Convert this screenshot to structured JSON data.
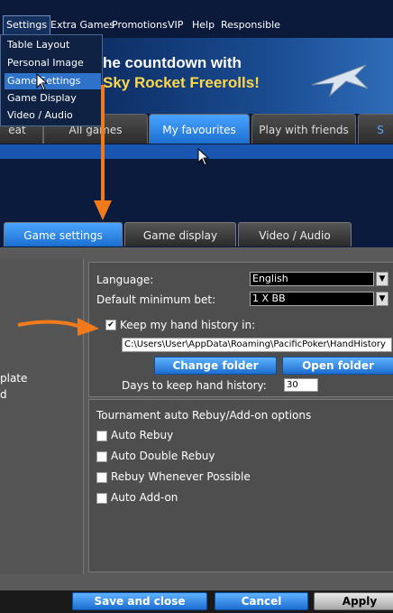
{
  "menubar": {
    "items": [
      "Settings",
      "Extra Games",
      "Promotions",
      "VIP",
      "Help",
      "Responsible"
    ]
  },
  "settings_menu": {
    "items": [
      "Table Layout",
      "Personal Image",
      "Game Settings",
      "Game Display",
      "Video / Audio"
    ],
    "highlighted": "Game Settings"
  },
  "banner": {
    "line1": "he countdown with",
    "line2": "Sky Rocket Freerolls!"
  },
  "lobby_tabs": [
    "eat",
    "All games",
    "My favourites",
    "Play with friends",
    "S"
  ],
  "lobby_tab_selected": "My favourites",
  "settings_tabs": [
    "Game settings",
    "Game display",
    "Video / Audio"
  ],
  "settings_tab_selected": "Game settings",
  "left_pane": {
    "items": [
      "plate",
      "d"
    ]
  },
  "game_settings": {
    "language_label": "Language:",
    "language_value": "English",
    "min_bet_label": "Default minimum bet:",
    "min_bet_value": "1 X BB",
    "hand_history_label": "Keep my hand history in:",
    "hand_history_checked": true,
    "hand_history_path": "C:\\Users\\User\\AppData\\Roaming\\PacificPoker\\HandHistory",
    "change_folder": "Change folder",
    "open_folder": "Open folder",
    "days_label": "Days to keep hand history:",
    "days_value": "30"
  },
  "tournament": {
    "heading": "Tournament auto Rebuy/Add-on options",
    "options": [
      "Auto Rebuy",
      "Auto Double Rebuy",
      "Rebuy Whenever Possible",
      "Auto Add-on"
    ]
  },
  "footer": {
    "save_close": "Save and close",
    "cancel": "Cancel",
    "apply": "Apply"
  },
  "colors": {
    "accent_blue": "#2e72c9",
    "annotation_arrow": "#f07a1c"
  }
}
